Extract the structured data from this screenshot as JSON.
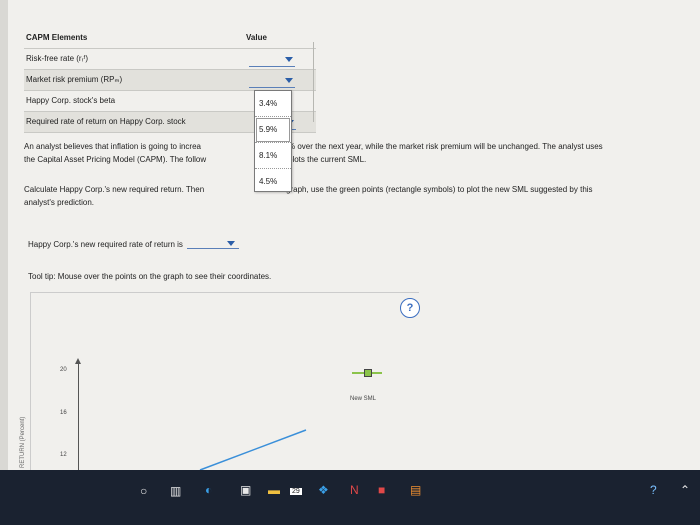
{
  "capm": {
    "header_label": "CAPM Elements",
    "header_value": "Value",
    "rows": [
      {
        "label": "Risk-free rate (rᵣᶠ)"
      },
      {
        "label": "Market risk premium (RPₘ)"
      },
      {
        "label": "Happy Corp. stock's beta"
      },
      {
        "label": "Required rate of return on Happy Corp. stock"
      }
    ]
  },
  "dropdown_list": [
    "3.4%",
    "5.9%",
    "8.1%",
    "4.5%"
  ],
  "paragraph1": {
    "line1_left": "An analyst believes that inflation is going to increa",
    "line1_right": "% over the next year, while the market risk premium will be unchanged. The analyst uses",
    "line2_left": "the Capital Asset Pricing Model (CAPM). The follow",
    "line2_right": "plots the current SML."
  },
  "paragraph2": {
    "line1_left": "Calculate Happy Corp.'s new required return. Then",
    "line1_right": "graph, use the green points (rectangle symbols) to plot the new SML suggested by this",
    "line2": "analyst's prediction."
  },
  "answer_prompt": "Happy Corp.'s new required rate of return is",
  "tooltip": "Tool tip: Mouse over the points on the graph to see their coordinates.",
  "help_label": "?",
  "graph": {
    "y_axis_label": "RETURN (Percent)",
    "y_ticks": [
      "20",
      "16",
      "12"
    ],
    "legend_label": "New SML",
    "colors": {
      "new_sml": "#8bc34a",
      "line": "#3a8fd9"
    }
  },
  "taskbar": {
    "badge": "29",
    "icons": [
      "search-icon",
      "task-view-icon",
      "edge-icon",
      "store-icon",
      "files-icon",
      "calendar-icon",
      "dropbox-icon",
      "app-n-icon",
      "app-red-icon",
      "app-image-icon"
    ]
  }
}
